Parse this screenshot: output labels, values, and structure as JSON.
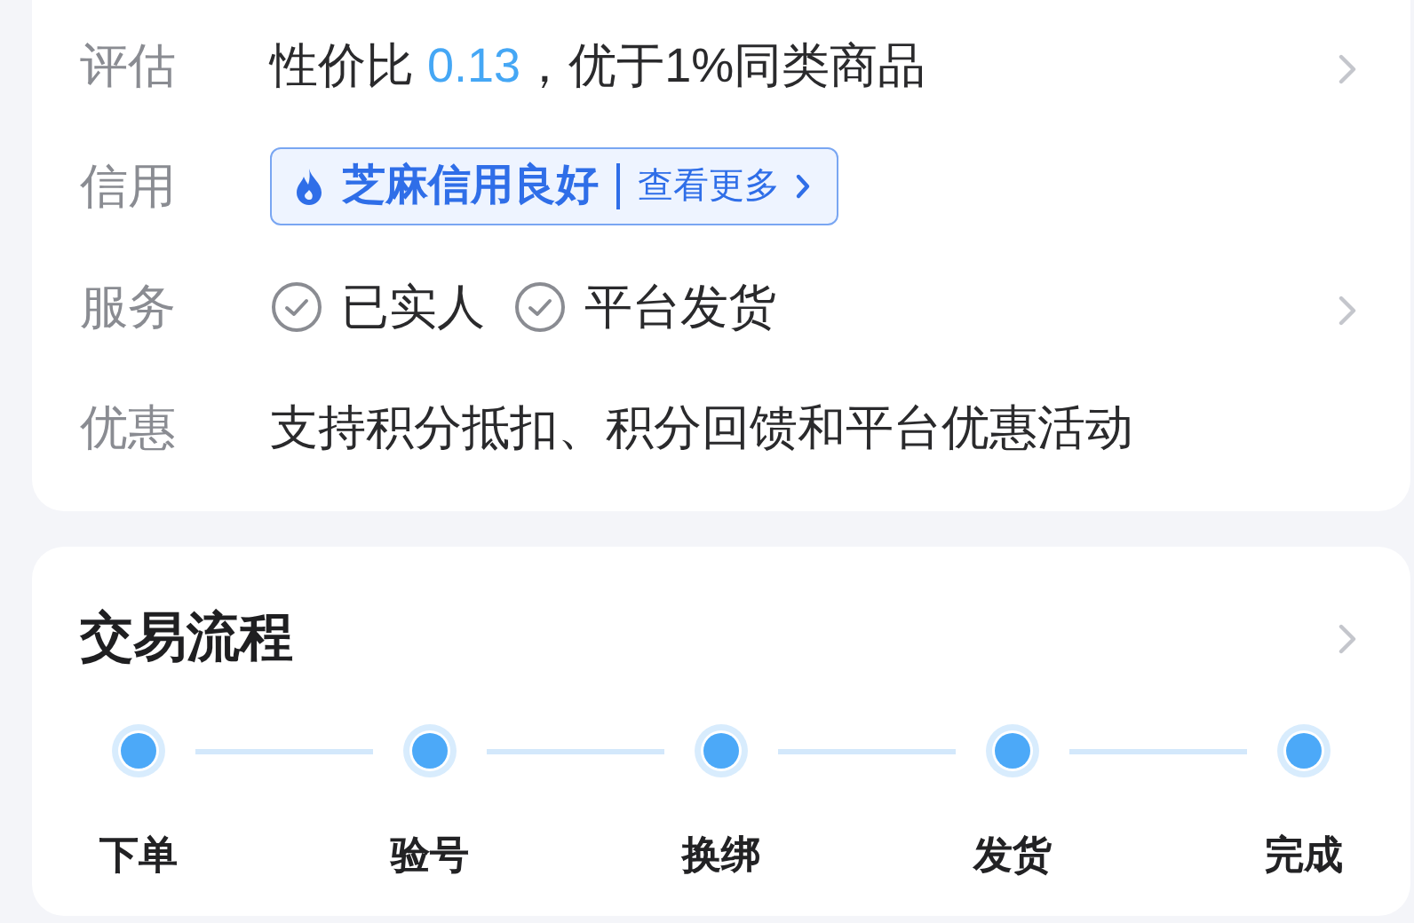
{
  "details": {
    "rows": [
      {
        "kind": "text",
        "label": "评估",
        "prefix": "性价比 ",
        "highlight": "0.13",
        "suffix": "，优于1%同类商品",
        "chevron": true
      },
      {
        "kind": "credit",
        "label": "信用",
        "badge": "芝麻信用良好",
        "link": "查看更多",
        "chevron": false
      },
      {
        "kind": "services",
        "label": "服务",
        "items": [
          "已实人",
          "平台发货"
        ],
        "chevron": true
      },
      {
        "kind": "text",
        "label": "优惠",
        "prefix": "支持积分抵扣、积分回馈和平台优惠活动",
        "chevron": false
      }
    ]
  },
  "process": {
    "title": "交易流程",
    "steps": [
      "下单",
      "验号",
      "换绑",
      "发货",
      "完成"
    ]
  }
}
